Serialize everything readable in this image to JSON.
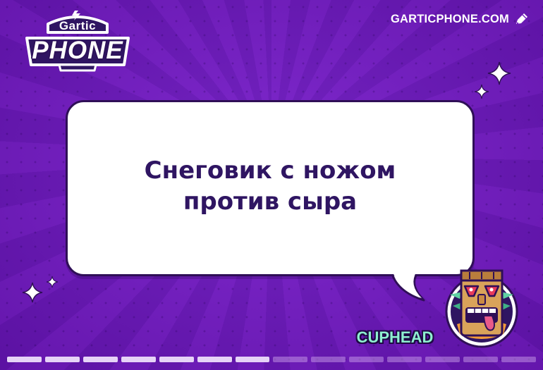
{
  "logo": {
    "top_word": "Gartic",
    "main_word": "PHONE"
  },
  "site_link": {
    "label": "GARTICPHONE.COM",
    "icon": "pencil-cursor-icon"
  },
  "prompt": {
    "text": "Снеговик с ножом против сыра"
  },
  "player": {
    "name": "CUPHEAD",
    "avatar": "tiki-mask-avatar"
  },
  "progress": {
    "total_segments": 14,
    "completed_segments": 7
  },
  "colors": {
    "background": "#7420c4",
    "bubble": "#ffffff",
    "prompt_text": "#2f1562",
    "player_name": "#8ef0d0",
    "outline": "#2f0f57"
  }
}
